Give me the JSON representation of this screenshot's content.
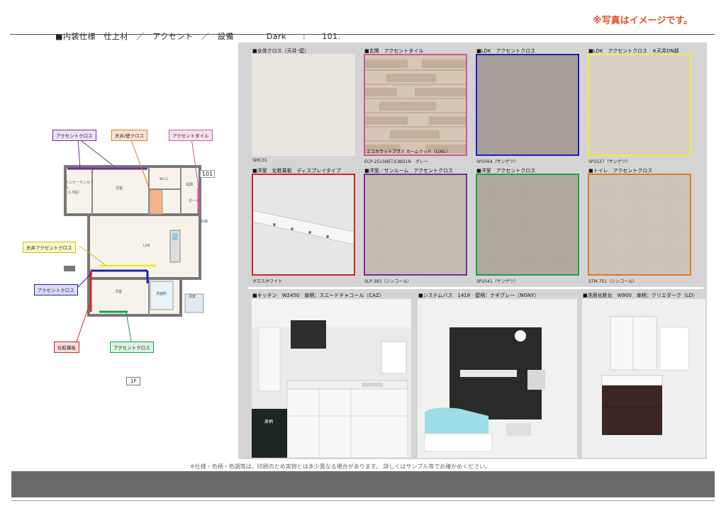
{
  "header": {
    "title": "■内装仕様　仕上材　／　アクセント　／　設備",
    "series": "Dark",
    "sep": ":",
    "unit": "101.",
    "note": "※写真はイメージです。"
  },
  "swatches": [
    {
      "label": "■全体クロス（天井･壁）",
      "code": "SMC31",
      "color": "#ede9e3"
    },
    {
      "label": "■玄関　アクセントタイル",
      "code": "ECP-2515NET/CWD1N　グレー",
      "color": "#d6c7b4",
      "overlay": "エコカラットプラス カームウッド（LIXIL）"
    },
    {
      "label": "■LDK　アクセントクロス",
      "code": "SP2564（サンゲツ）",
      "color": "#aaa39b"
    },
    {
      "label": "■LDK　アクセントクロス　※天井DN部",
      "code": "SP2537（サンゲツ）",
      "color": "#ddd4c9"
    },
    {
      "label": "■洋室　化粧幕板　ディスプレイタイプ",
      "code": "グロスホワイト",
      "color": "#e6e6e4"
    },
    {
      "label": "■洋室／サンルーム　アクセントクロス",
      "code": "SLP-383（シンコール）",
      "color": "#c8bfb5"
    },
    {
      "label": "■洋室　アクセントクロス",
      "code": "SP2541（サンゲツ）",
      "color": "#b4aca3"
    },
    {
      "label": "■トイレ　アクセントクロス",
      "code": "STM-751（シンコール）",
      "color": "#cfc8be"
    }
  ],
  "equipment": [
    {
      "label": "■キッチン　W2450　扉柄：スエードチャコール（CAZ）",
      "badge": "扉柄"
    },
    {
      "label": "■システムバス　1418　壁柄：ナギグレー（NGNY）"
    },
    {
      "label": "■洗面化粧台　W900　扉柄：クリエダーク（LD）"
    }
  ],
  "callouts": {
    "accent_cross_top": "アクセントクロス",
    "ceiling_wall_cross": "天井/壁クロス",
    "accent_tile": "アクセントタイル",
    "ceiling_accent_cross": "天井アクセントクロス",
    "accent_cross_left": "アクセントクロス",
    "decor_board": "化粧幕板",
    "accent_cross_bottom": "アクセントクロス"
  },
  "plan": {
    "unit_no": "101",
    "rooms": {
      "western_top": "洋室",
      "sunroom": "インナーサンルーム\n（1.9帖）",
      "wic": "W.I.C",
      "genkan": "玄関",
      "hall": "ホール",
      "ldk": "LDK",
      "western_bottom": "洋室",
      "wash": "洗面所",
      "bath": "浴室",
      "storage": "収納"
    },
    "floor": "1F"
  },
  "colors": {
    "purple": "#7030a0",
    "pink": "#d0569e",
    "blue": "#1f1fc0",
    "yellow": "#f2ea3c",
    "red": "#d02828",
    "green": "#16a34a",
    "orange": "#e07a1f",
    "note_red": "#e2502e"
  },
  "footer": {
    "note": "※仕様・色柄・色調等は、印刷のため実物とは多少異なる場合があります。 詳しくはサンプル等でお確かめください。"
  }
}
